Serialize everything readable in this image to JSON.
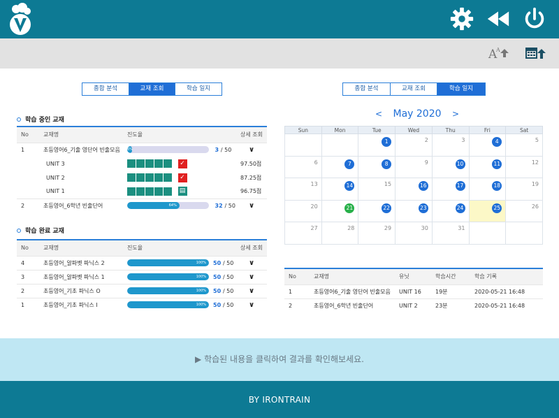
{
  "header": {
    "brand": "V"
  },
  "left_tabs": [
    "종합 분석",
    "교재 조회",
    "학습 일지"
  ],
  "left_active": 1,
  "right_tabs": [
    "종합 분석",
    "교재 조회",
    "학습 일지"
  ],
  "right_active": 2,
  "studying": {
    "title": "학습 중인 교재",
    "columns": [
      "No",
      "교재명",
      "진도율",
      "상세 조회"
    ],
    "rows": [
      {
        "no": "1",
        "name": "초등영어6_기출 영단어 빈출모음",
        "percent": 6,
        "pct_label": "6%",
        "done": "3",
        "total": "/ 50"
      },
      {
        "no": "2",
        "name": "초등영어_6학년 빈출단어",
        "percent": 64,
        "pct_label": "64%",
        "done": "32",
        "total": "/ 50"
      }
    ],
    "units": [
      {
        "name": "UNIT 3",
        "score": "97.50점",
        "state": "done"
      },
      {
        "name": "UNIT 2",
        "score": "87.25점",
        "state": "done"
      },
      {
        "name": "UNIT 1",
        "score": "96.75점",
        "state": "pending"
      }
    ]
  },
  "completed": {
    "title": "학습 완료 교재",
    "columns": [
      "No",
      "교재명",
      "진도율",
      "상세 조회"
    ],
    "rows": [
      {
        "no": "4",
        "name": "초등영어_알파벳 파닉스 2",
        "percent": 100,
        "pct_label": "100%",
        "done": "50",
        "total": "/ 50"
      },
      {
        "no": "3",
        "name": "초등영어_알파벳 파닉스 1",
        "percent": 100,
        "pct_label": "100%",
        "done": "50",
        "total": "/ 50"
      },
      {
        "no": "2",
        "name": "초등영어_기초 파닉스 O",
        "percent": 100,
        "pct_label": "100%",
        "done": "50",
        "total": "/ 50"
      },
      {
        "no": "1",
        "name": "초등영어_기초 파닉스 I",
        "percent": 100,
        "pct_label": "100%",
        "done": "50",
        "total": "/ 50"
      }
    ]
  },
  "calendar": {
    "month_label": "May 2020",
    "prev": "<",
    "next": ">",
    "weekdays": [
      "Sun",
      "Mon",
      "Tue",
      "Wed",
      "Thu",
      "Fri",
      "Sat"
    ],
    "weeks": [
      [
        "",
        "",
        "1",
        "2",
        "3",
        "4",
        "5"
      ],
      [
        "6",
        "7",
        "8",
        "9",
        "10",
        "11",
        "12"
      ],
      [
        "13",
        "14",
        "15",
        "16",
        "17",
        "18",
        "19"
      ],
      [
        "20",
        "21",
        "22",
        "23",
        "24",
        "25",
        "26"
      ],
      [
        "27",
        "28",
        "29",
        "30",
        "31",
        "",
        ""
      ]
    ],
    "study_days": [
      "1",
      "4",
      "7",
      "8",
      "10",
      "11",
      "14",
      "16",
      "17",
      "18",
      "22",
      "23",
      "24",
      "25"
    ],
    "green_day": "21",
    "today": "25",
    "badge_color": "#1f6ed6",
    "green_color": "#28b04a"
  },
  "log": {
    "columns": [
      "No",
      "교재명",
      "유닛",
      "학습시간",
      "학습 기록"
    ],
    "rows": [
      {
        "no": "1",
        "name": "초등영어6_기출 영단어 빈출모음",
        "unit": "UNIT 16",
        "time": "19분",
        "record": "2020-05-21 16:48"
      },
      {
        "no": "2",
        "name": "초등영어_6학년 빈출단어",
        "unit": "UNIT 2",
        "time": "23분",
        "record": "2020-05-21 16:48"
      }
    ]
  },
  "bottom_message": "▶ 학습된 내용을 클릭하여 결과를 확인해보세요.",
  "footer": "BY IRONTRAIN",
  "colors": {
    "brand": "#0d7a94",
    "accent": "#1f6ed6",
    "bar": "#bfe7f3"
  }
}
